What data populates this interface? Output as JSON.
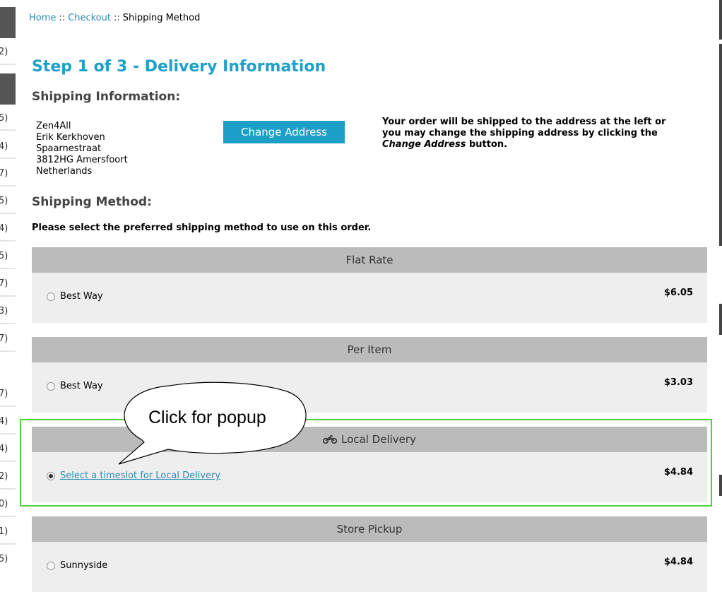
{
  "sidebar": {
    "counts": [
      "2)",
      "5)",
      "4)",
      "7)",
      "5)",
      "4)",
      "5)",
      "7)",
      "3)",
      "7)",
      "7)",
      "4)",
      "4)",
      "2)",
      "0)",
      "1)",
      "5)"
    ]
  },
  "breadcrumb": {
    "home": "Home",
    "sep1": "::",
    "checkout": "Checkout",
    "sep2": "::",
    "current": "Shipping Method"
  },
  "page": {
    "title": "Step 1 of 3 - Delivery Information",
    "shipping_info_heading": "Shipping Information:",
    "address": [
      "Zen4All",
      "Erik Kerkhoven",
      "Spaarnestraat",
      "3812HG Amersfoort",
      "Netherlands"
    ],
    "change_address_label": "Change Address",
    "ship_note_before": "Your order will be shipped to the address at the left or you may change the shipping address by clicking the ",
    "ship_note_em": "Change Address",
    "ship_note_after": " button.",
    "shipping_method_heading": "Shipping Method:",
    "instructions": "Please select the preferred shipping method to use on this order."
  },
  "methods": [
    {
      "title": "Flat Rate",
      "option": "Best Way",
      "price": "$6.05",
      "selected": false
    },
    {
      "title": "Per Item",
      "option": "Best Way",
      "price": "$3.03",
      "selected": false
    },
    {
      "title": "Local Delivery",
      "icon": "motorcycle-icon",
      "option": "Select a timeslot for Local Delivery",
      "price": "$4.84",
      "selected": true
    },
    {
      "title": "Store Pickup",
      "option": "Sunnyside",
      "price": "$4.84",
      "selected": false
    }
  ],
  "annotation": {
    "callout_text": "Click for popup",
    "highlight_color": "#4fd13f"
  },
  "colors": {
    "accent": "#1fa0c8",
    "button": "#1b9fc7",
    "method_header": "#bbbbbb",
    "method_body": "#eeeeee"
  }
}
